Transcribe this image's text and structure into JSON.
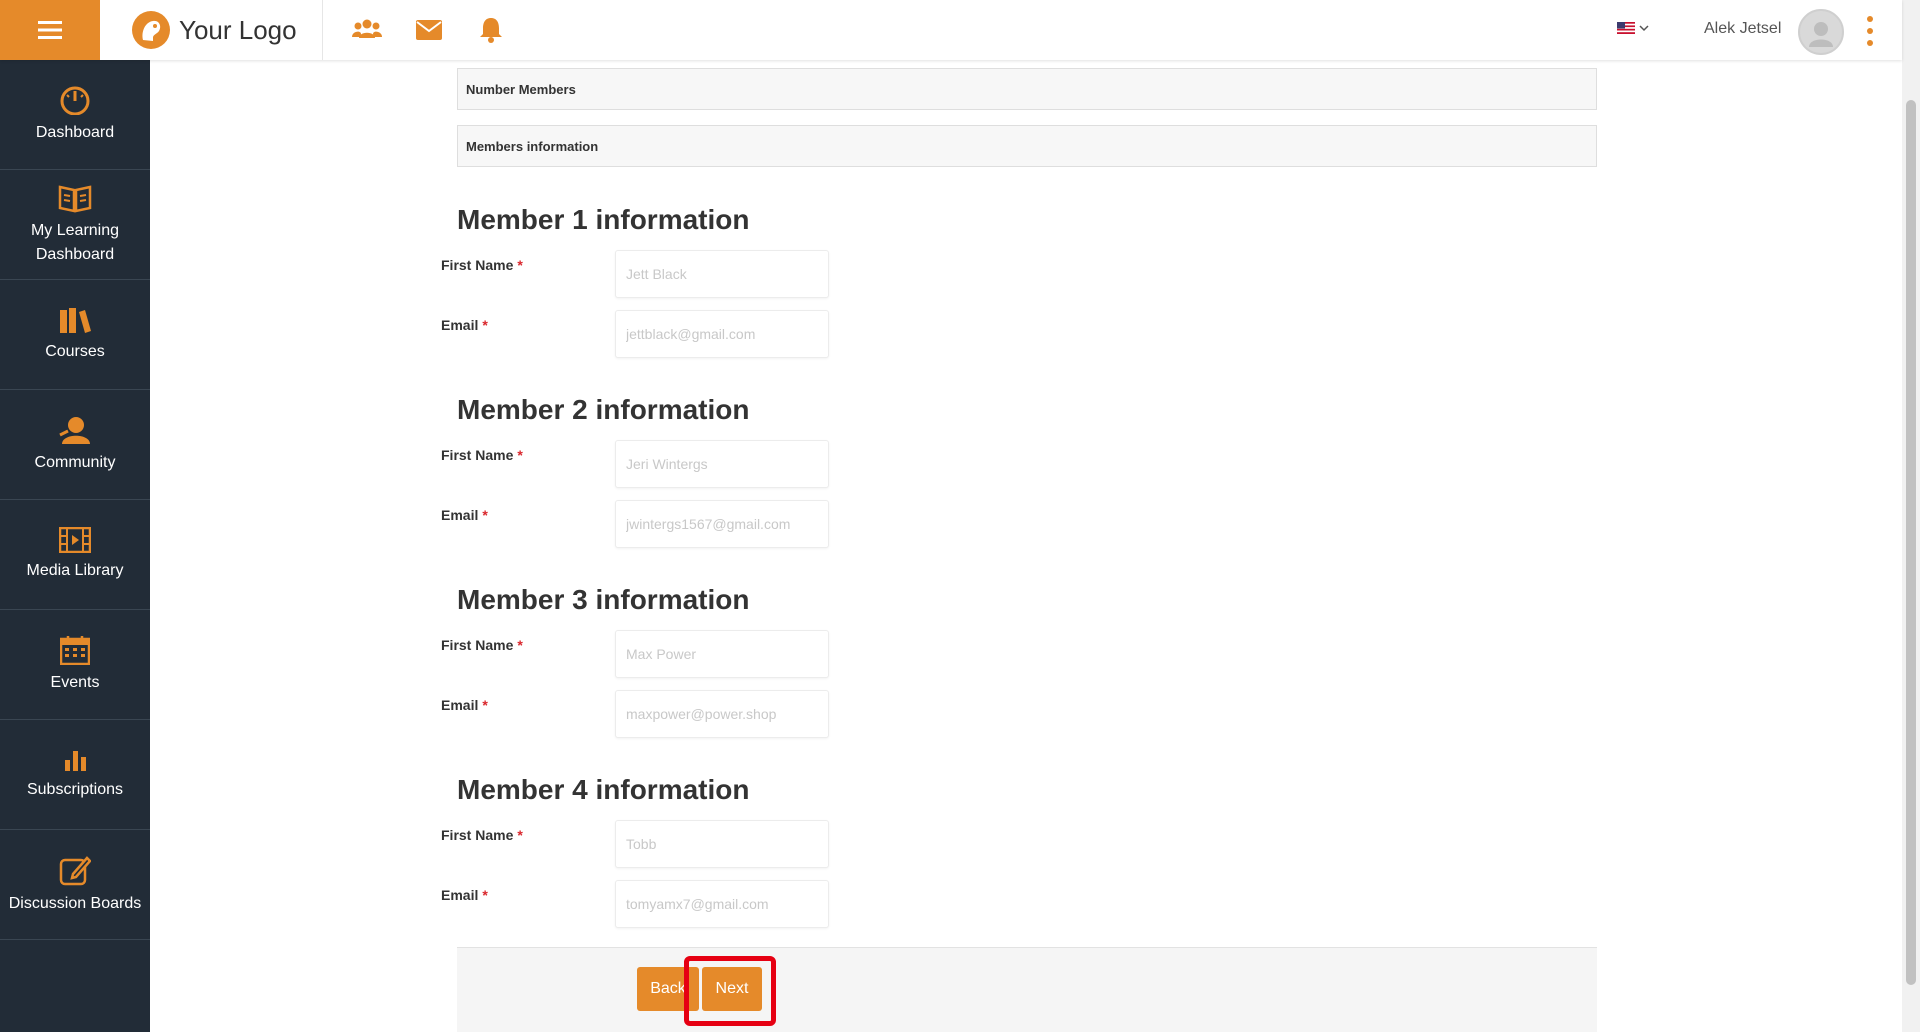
{
  "header": {
    "logo_text": "Your Logo",
    "username": "Alek Jetsel",
    "icons": [
      "users-icon",
      "envelope-icon",
      "bell-icon"
    ],
    "language_flag": "us-flag-icon"
  },
  "sidebar": {
    "items": [
      {
        "label": "Dashboard",
        "icon": "gauge-icon"
      },
      {
        "label": "My Learning Dashboard",
        "icon": "book-icon"
      },
      {
        "label": "Courses",
        "icon": "books-icon"
      },
      {
        "label": "Community",
        "icon": "person-icon"
      },
      {
        "label": "Media Library",
        "icon": "film-icon"
      },
      {
        "label": "Events",
        "icon": "calendar-icon"
      },
      {
        "label": "Subscriptions",
        "icon": "bar-chart-icon"
      },
      {
        "label": "Discussion Boards",
        "icon": "edit-icon"
      }
    ]
  },
  "panels": {
    "number_members": "Number Members",
    "members_information": "Members information"
  },
  "form": {
    "first_name_label": "First Name",
    "email_label": "Email",
    "required_mark": "*",
    "members": [
      {
        "title": "Member 1 information",
        "first_name": "Jett Black",
        "email": "jettblack@gmail.com"
      },
      {
        "title": "Member 2 information",
        "first_name": "Jeri Wintergs",
        "email": "jwintergs1567@gmail.com"
      },
      {
        "title": "Member 3 information",
        "first_name": "Max Power",
        "email": "maxpower@power.shop"
      },
      {
        "title": "Member 4 information",
        "first_name": "Tobb",
        "email": "tomyamx7@gmail.com"
      }
    ]
  },
  "buttons": {
    "back": "Back",
    "next": "Next"
  },
  "colors": {
    "accent": "#e58a2a",
    "sidebar_bg": "#222c37",
    "highlight": "#e60012"
  }
}
